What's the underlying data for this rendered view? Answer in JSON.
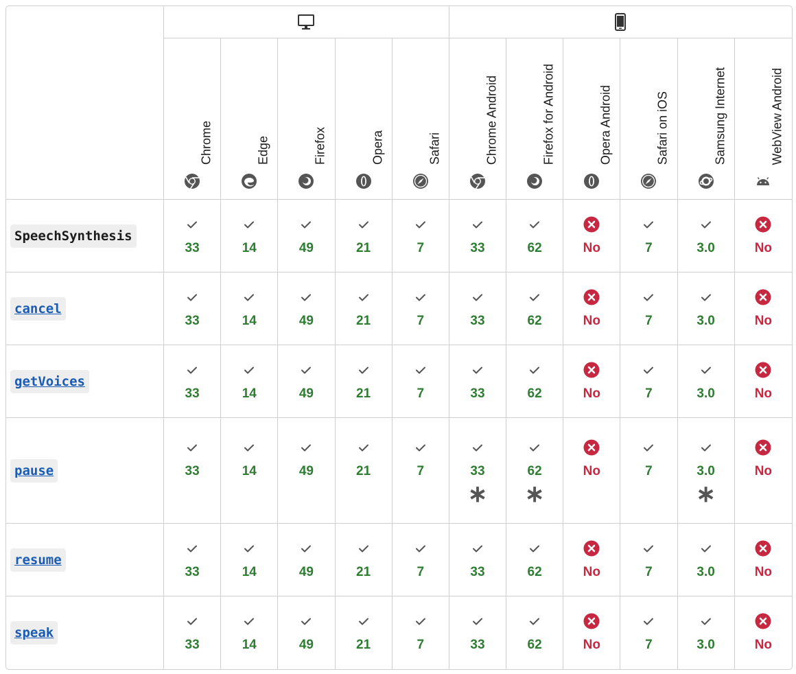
{
  "platforms": {
    "desktop_icon": "desktop-icon",
    "mobile_icon": "mobile-icon"
  },
  "browsers": [
    {
      "name": "Chrome",
      "icon": "chrome-logo-icon",
      "platform": "desktop"
    },
    {
      "name": "Edge",
      "icon": "edge-logo-icon",
      "platform": "desktop"
    },
    {
      "name": "Firefox",
      "icon": "firefox-logo-icon",
      "platform": "desktop"
    },
    {
      "name": "Opera",
      "icon": "opera-logo-icon",
      "platform": "desktop"
    },
    {
      "name": "Safari",
      "icon": "safari-logo-icon",
      "platform": "desktop"
    },
    {
      "name": "Chrome Android",
      "icon": "chrome-logo-icon",
      "platform": "mobile"
    },
    {
      "name": "Firefox for Android",
      "icon": "firefox-logo-icon",
      "platform": "mobile"
    },
    {
      "name": "Opera Android",
      "icon": "opera-logo-icon",
      "platform": "mobile"
    },
    {
      "name": "Safari on iOS",
      "icon": "safari-logo-icon",
      "platform": "mobile"
    },
    {
      "name": "Samsung Internet",
      "icon": "samsung-internet-logo-icon",
      "platform": "mobile"
    },
    {
      "name": "WebView Android",
      "icon": "android-logo-icon",
      "platform": "mobile"
    }
  ],
  "colors": {
    "supported": "#2e7d32",
    "unsupported": "#c62842",
    "link": "#1a5cb4"
  },
  "features": [
    {
      "name": "SpeechSynthesis",
      "link": false,
      "support": [
        "33",
        "14",
        "49",
        "21",
        "7",
        "33",
        "62",
        "No",
        "7",
        "3.0",
        "No"
      ],
      "notes": []
    },
    {
      "name": "cancel",
      "link": true,
      "support": [
        "33",
        "14",
        "49",
        "21",
        "7",
        "33",
        "62",
        "No",
        "7",
        "3.0",
        "No"
      ],
      "notes": []
    },
    {
      "name": "getVoices",
      "link": true,
      "support": [
        "33",
        "14",
        "49",
        "21",
        "7",
        "33",
        "62",
        "No",
        "7",
        "3.0",
        "No"
      ],
      "notes": []
    },
    {
      "name": "pause",
      "link": true,
      "support": [
        "33",
        "14",
        "49",
        "21",
        "7",
        "33",
        "62",
        "No",
        "7",
        "3.0",
        "No"
      ],
      "notes": [
        5,
        6,
        9
      ]
    },
    {
      "name": "resume",
      "link": true,
      "support": [
        "33",
        "14",
        "49",
        "21",
        "7",
        "33",
        "62",
        "No",
        "7",
        "3.0",
        "No"
      ],
      "notes": []
    },
    {
      "name": "speak",
      "link": true,
      "support": [
        "33",
        "14",
        "49",
        "21",
        "7",
        "33",
        "62",
        "No",
        "7",
        "3.0",
        "No"
      ],
      "notes": []
    }
  ],
  "note_symbol": "∗"
}
